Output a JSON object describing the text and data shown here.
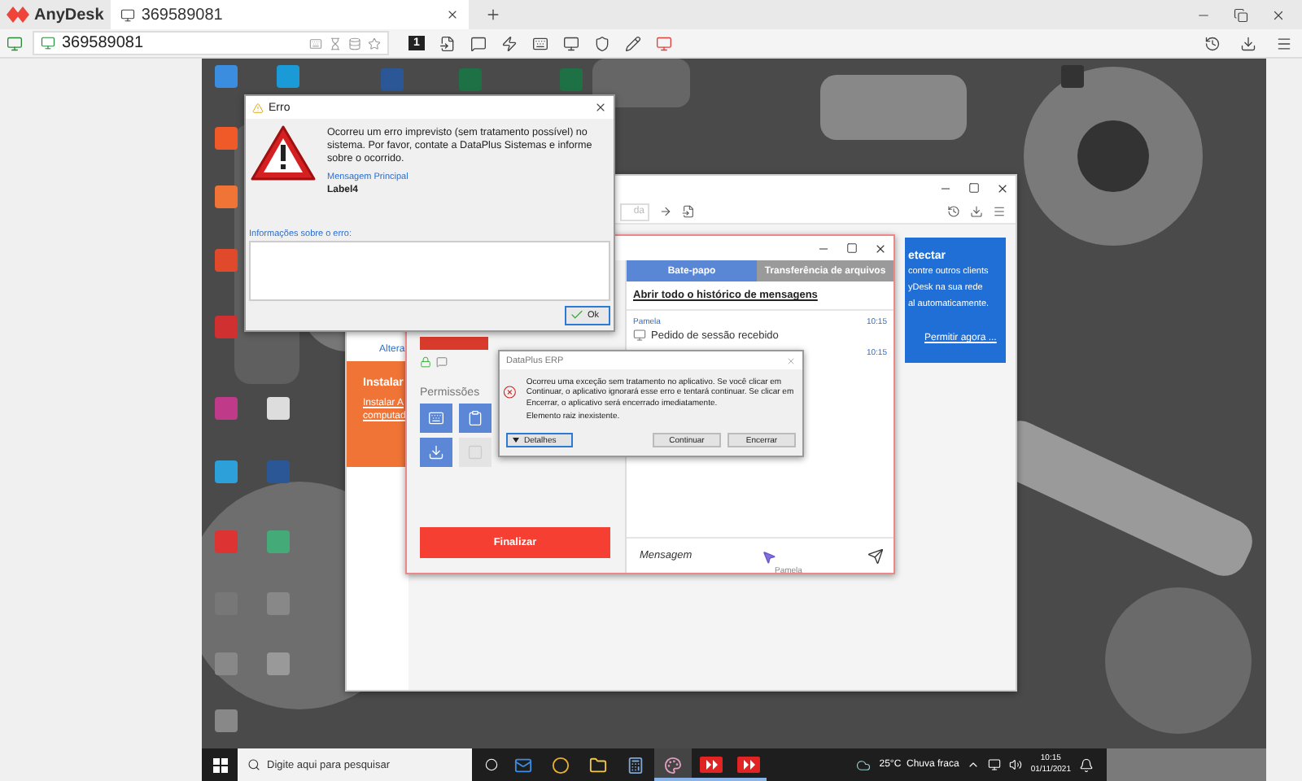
{
  "anydesk": {
    "app_name": "AnyDesk",
    "tabs": [
      {
        "label": "369589081",
        "selected": true
      }
    ],
    "address": "369589081",
    "display_badge": "1"
  },
  "remote_anydesk": {
    "search_value": "da",
    "change_link": "Altera",
    "install": {
      "title": "Instalar",
      "link": "Instalar A computad"
    },
    "discovery": {
      "title": "etectar",
      "lines": [
        "contre outros clients",
        "yDesk na sua rede",
        "al automaticamente."
      ],
      "link": "Permitir agora ..."
    }
  },
  "session_window": {
    "permissions_title": "Permissões",
    "permissions": [
      {
        "on": true
      },
      {
        "on": true
      },
      {
        "on": true
      },
      {
        "on": false
      }
    ],
    "finish_button": "Finalizar",
    "tabs": [
      {
        "label": "Bate-papo",
        "selected": true
      },
      {
        "label": "Transferência de arquivos",
        "selected": false
      }
    ],
    "history_link": "Abrir todo o histórico de mensagens",
    "messages": [
      {
        "sender": "Pamela",
        "time": "10:15",
        "text": "Pedido de sessão recebido"
      },
      {
        "time": "10:15"
      }
    ],
    "message_placeholder": "Mensagem",
    "cursor_label": "Pamela"
  },
  "error_dialog": {
    "title": "Erro",
    "message": "Ocorreu um erro imprevisto (sem tratamento possível) no sistema. Por favor, contate a DataPlus Sistemas e informe sobre o ocorrido.",
    "caption": "Mensagem Principal",
    "value": "Label4",
    "info_label": "Informações sobre o erro:",
    "ok_button": "Ok"
  },
  "erp_dialog": {
    "title": "DataPlus ERP",
    "message": "Ocorreu uma exceção sem tratamento no aplicativo. Se você clicar em Continuar, o aplicativo ignorará esse erro e tentará continuar. Se clicar em Encerrar, o aplicativo será encerrado imediatamente.",
    "detail": "Elemento raiz inexistente.",
    "buttons": [
      {
        "label": "Detalhes",
        "kind": "expander",
        "focused": true
      },
      {
        "label": "Continuar",
        "kind": "action",
        "focused": false
      },
      {
        "label": "Encerrar",
        "kind": "action",
        "focused": false
      }
    ]
  },
  "taskbar": {
    "search_placeholder": "Digite aqui para pesquisar",
    "apps": [
      {
        "kind": "mail",
        "active": false,
        "running": false
      },
      {
        "kind": "browser",
        "active": false,
        "running": false
      },
      {
        "kind": "folder",
        "active": false,
        "running": false
      },
      {
        "kind": "calculator",
        "active": false,
        "running": false
      },
      {
        "kind": "paint",
        "active": true,
        "running": true
      },
      {
        "kind": "remote",
        "active": false,
        "running": true
      },
      {
        "kind": "remote",
        "active": false,
        "running": true
      }
    ],
    "weather": "25°C  Chuva fraca",
    "time": "10:15",
    "date": "01/11/2021"
  }
}
